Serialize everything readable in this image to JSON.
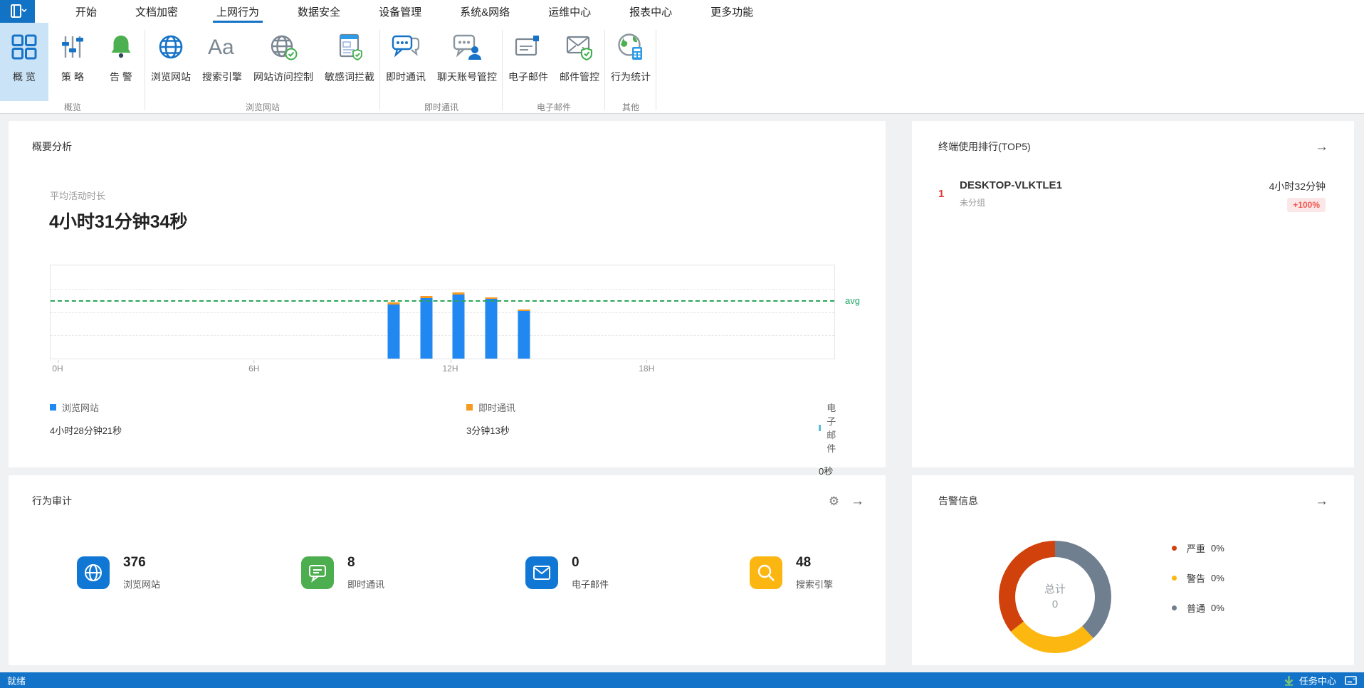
{
  "theme": {
    "accent": "#1673c8",
    "statusbar_bg": "#1273c8",
    "selected_ribbon_bg": "#cae3f7",
    "content_bg": "#f0f1f2"
  },
  "menu": {
    "tabs": [
      {
        "label": "开始"
      },
      {
        "label": "文档加密"
      },
      {
        "label": "上网行为",
        "active": true
      },
      {
        "label": "数据安全"
      },
      {
        "label": "设备管理"
      },
      {
        "label": "系统&网络"
      },
      {
        "label": "运维中心"
      },
      {
        "label": "报表中心"
      },
      {
        "label": "更多功能"
      }
    ]
  },
  "ribbon": {
    "groups": [
      {
        "label": "概览",
        "items": [
          {
            "label": "概 览",
            "icon": "grid-overview-icon",
            "selected": true
          },
          {
            "label": "策 略",
            "icon": "sliders-icon"
          },
          {
            "label": "告 警",
            "icon": "bell-icon"
          }
        ]
      },
      {
        "label": "浏览网站",
        "items": [
          {
            "label": "浏览网站",
            "icon": "globe-icon"
          },
          {
            "label": "搜索引擎",
            "icon": "letters-Aa-icon"
          },
          {
            "label": "网站访问控制",
            "icon": "globe-check-icon"
          },
          {
            "label": "敏感词拦截",
            "icon": "document-shield-icon"
          }
        ]
      },
      {
        "label": "即时通讯",
        "items": [
          {
            "label": "即时通讯",
            "icon": "chat-bubbles-icon"
          },
          {
            "label": "聊天账号管控",
            "icon": "chat-user-icon"
          }
        ]
      },
      {
        "label": "电子邮件",
        "items": [
          {
            "label": "电子邮件",
            "icon": "envelope-icon"
          },
          {
            "label": "邮件管控",
            "icon": "envelope-shield-icon"
          }
        ]
      },
      {
        "label": "其他",
        "items": [
          {
            "label": "行为统计",
            "icon": "globe-calculator-icon"
          }
        ]
      }
    ]
  },
  "summary_panel": {
    "title": "概要分析",
    "avg_label": "平均活动时长",
    "avg_value": "4小时31分钟34秒",
    "avg_line_label": "avg",
    "legend": [
      {
        "name": "浏览网站",
        "value": "4小时28分钟21秒",
        "color": "#2188f2"
      },
      {
        "name": "即时通讯",
        "value": "3分钟13秒",
        "color": "#f59a23"
      },
      {
        "name": "电子邮件",
        "value": "0秒",
        "color": "#56c2d6"
      }
    ]
  },
  "chart_data": [
    {
      "type": "bar",
      "title": "平均活动时长按小时分布",
      "x_axis_range": [
        0,
        24
      ],
      "x_axis_tick_hours": [
        0,
        6,
        12,
        18
      ],
      "x_axis_tick_labels": [
        "0H",
        "6H",
        "12H",
        "18H"
      ],
      "x": [
        10,
        11,
        12,
        13,
        14
      ],
      "series": [
        {
          "name": "浏览网站",
          "color": "#2188f2",
          "values_pct_of_axis": [
            58,
            65,
            69,
            64,
            51
          ],
          "total": "4小时28分钟21秒"
        },
        {
          "name": "即时通讯",
          "color": "#f59a23",
          "values_pct_of_axis": [
            2,
            2,
            2,
            2,
            2
          ],
          "total": "3分钟13秒"
        },
        {
          "name": "电子邮件",
          "color": "#56c2d6",
          "values_pct_of_axis": [
            0,
            0,
            0,
            0,
            0
          ],
          "total": "0秒"
        }
      ],
      "avg_line_pct_of_axis": 61,
      "avg_line_label": "avg",
      "grid": "horizontal-dashed",
      "legend_position": "bottom"
    },
    {
      "type": "pie",
      "variant": "donut",
      "title": "告警信息",
      "center_label": "总计",
      "center_value": "0",
      "slices": [
        {
          "name": "普通",
          "display": "0%",
          "angle_deg": 137,
          "color": "#6f7f90"
        },
        {
          "name": "警告",
          "display": "0%",
          "angle_deg": 95,
          "color": "#fcb810"
        },
        {
          "name": "严重",
          "display": "0%",
          "angle_deg": 128,
          "color": "#d1410c"
        }
      ],
      "legend_position": "right"
    }
  ],
  "top5_panel": {
    "title": "终端使用排行(TOP5)",
    "arrow_icon": "→",
    "rank_color": "#e23c39",
    "badge_bg": "#fbe7e7",
    "badge_color": "#f0574f",
    "entries": [
      {
        "rank": "1",
        "name": "DESKTOP-VLKTLE1",
        "group": "未分组",
        "duration": "4小时32分钟",
        "change": "+100%"
      }
    ]
  },
  "audit_panel": {
    "title": "行为审计",
    "gear_icon": "⚙",
    "arrow_icon": "→",
    "stats": [
      {
        "value": "376",
        "label": "浏览网站",
        "icon": "globe-icon",
        "color": "#1177d4"
      },
      {
        "value": "8",
        "label": "即时通讯",
        "icon": "chat-icon",
        "color": "#4cae4f"
      },
      {
        "value": "0",
        "label": "电子邮件",
        "icon": "mail-icon",
        "color": "#1177d4"
      },
      {
        "value": "48",
        "label": "搜索引擎",
        "icon": "search-icon",
        "color": "#fbb612"
      }
    ]
  },
  "alert_panel": {
    "title": "告警信息",
    "arrow_icon": "→",
    "center_label": "总计",
    "center_value": "0",
    "legend": [
      {
        "name": "严重",
        "value": "0%",
        "color": "#d1410c"
      },
      {
        "name": "警告",
        "value": "0%",
        "color": "#fcb810"
      },
      {
        "name": "普通",
        "value": "0%",
        "color": "#6f7f90"
      }
    ]
  },
  "status_bar": {
    "left": "就绪",
    "task_center": "任务中心"
  }
}
